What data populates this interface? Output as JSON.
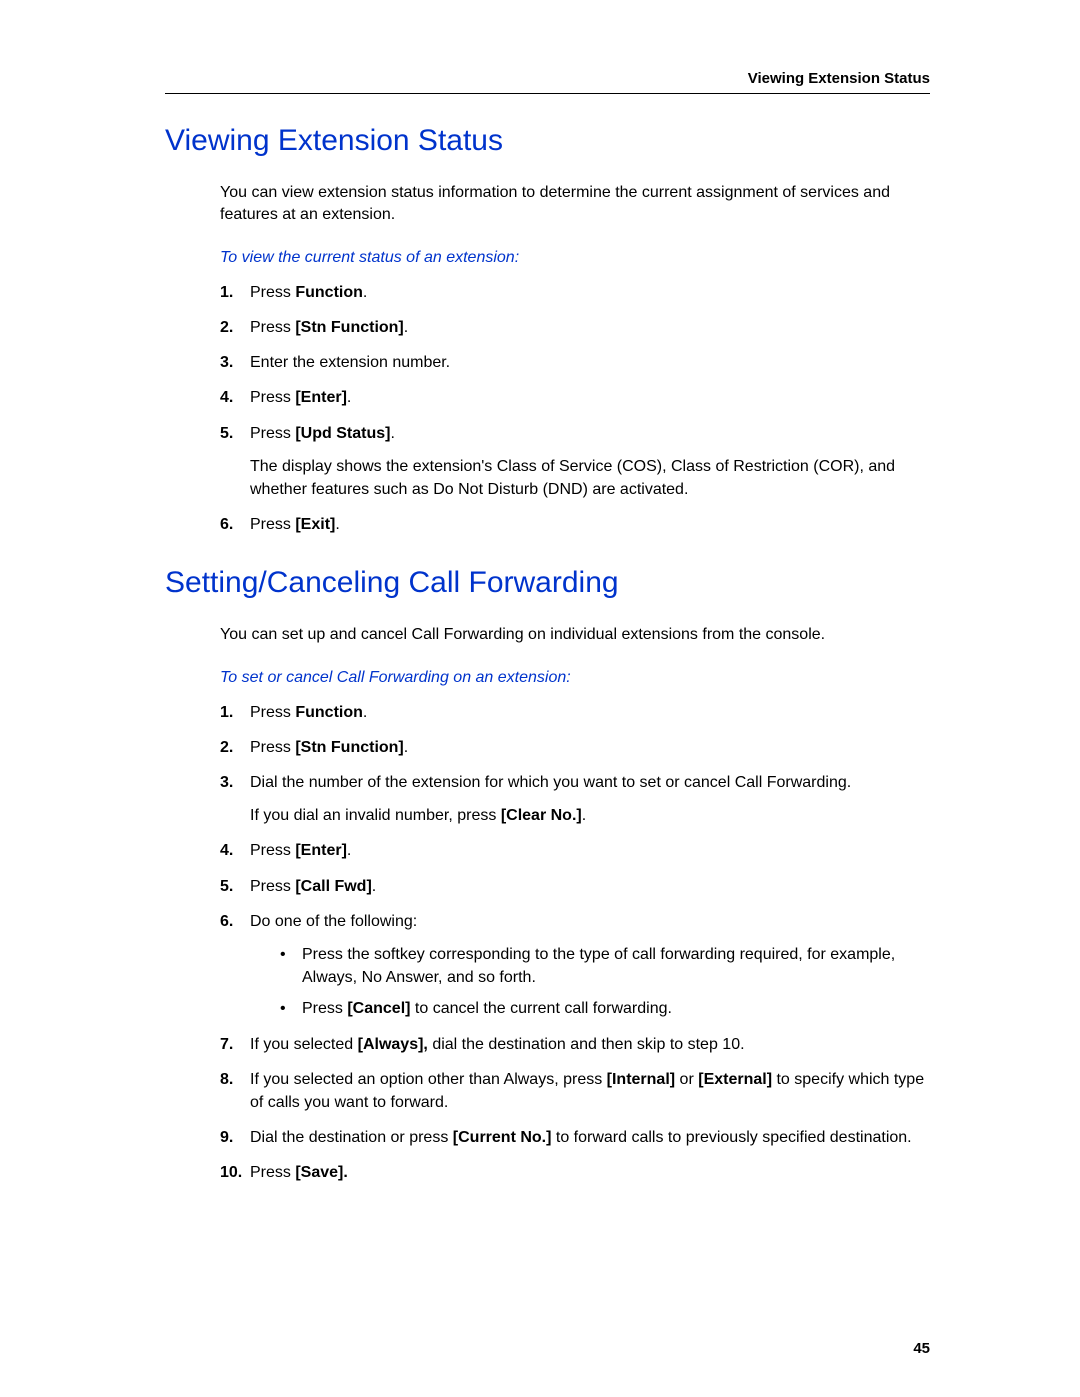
{
  "header": {
    "running": "Viewing Extension Status"
  },
  "section1": {
    "title": "Viewing Extension Status",
    "intro": "You can view extension status information to determine the current assignment of services and features at an extension.",
    "subhead": "To view the current status of an extension:",
    "steps": {
      "s1": {
        "n": "1.",
        "pre": "Press ",
        "bold": "Function",
        "post": "."
      },
      "s2": {
        "n": "2.",
        "pre": "Press ",
        "bold": "[Stn Function]",
        "post": "."
      },
      "s3": {
        "n": "3.",
        "text": "Enter the extension number."
      },
      "s4": {
        "n": "4.",
        "pre": "Press ",
        "bold": "[Enter]",
        "post": "."
      },
      "s5": {
        "n": "5.",
        "pre": "Press ",
        "bold": "[Upd Status]",
        "post": ".",
        "extra": "The display shows the extension's Class of Service (COS), Class of Restriction (COR), and whether features such as Do Not Disturb (DND) are activated."
      },
      "s6": {
        "n": "6.",
        "pre": "Press ",
        "bold": "[Exit]",
        "post": "."
      }
    }
  },
  "section2": {
    "title": "Setting/Canceling Call Forwarding",
    "intro": "You can set up and cancel Call Forwarding on individual extensions from the console.",
    "subhead": "To set or cancel Call Forwarding on an extension:",
    "steps": {
      "s1": {
        "n": "1.",
        "pre": "Press ",
        "bold": "Function",
        "post": "."
      },
      "s2": {
        "n": "2.",
        "pre": "Press ",
        "bold": "[Stn Function]",
        "post": "."
      },
      "s3": {
        "n": "3.",
        "text": "Dial the number of the extension for which you want to set or cancel Call Forwarding.",
        "extra_pre": "If you dial an invalid number, press ",
        "extra_bold": "[Clear No.]",
        "extra_post": "."
      },
      "s4": {
        "n": "4.",
        "pre": "Press ",
        "bold": "[Enter]",
        "post": "."
      },
      "s5": {
        "n": "5.",
        "pre": "Press ",
        "bold": "[Call Fwd]",
        "post": "."
      },
      "s6": {
        "n": "6.",
        "text": "Do one of the following:",
        "b1": "Press the softkey corresponding to the type of call forwarding required, for example, Always, No Answer, and so forth.",
        "b2_pre": "Press ",
        "b2_bold": "[Cancel]",
        "b2_post": " to cancel the current call forwarding."
      },
      "s7": {
        "n": "7.",
        "pre": "If you selected ",
        "bold": "[Always],",
        "post": " dial the destination and then skip to step 10."
      },
      "s8": {
        "n": "8.",
        "pre": "If you selected an option other than Always, press ",
        "bold1": "[Internal]",
        "mid": " or ",
        "bold2": "[External]",
        "post": " to specify which type of calls you want to forward."
      },
      "s9": {
        "n": "9.",
        "pre": "Dial the destination or press ",
        "bold": "[Current No.]",
        "post": " to forward calls to previously specified destination."
      },
      "s10": {
        "n": "10.",
        "pre": "Press ",
        "bold": "[Save].",
        "post": ""
      }
    }
  },
  "footer": {
    "page": "45"
  }
}
